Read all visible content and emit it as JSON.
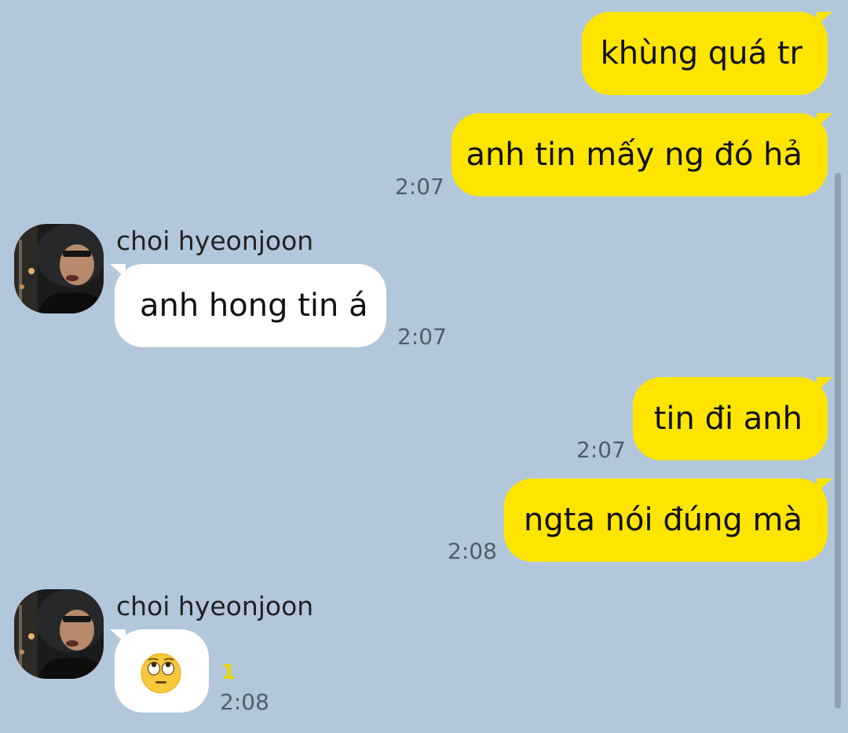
{
  "messages": [
    {
      "sender": "me",
      "text": "khùng quá tr"
    },
    {
      "sender": "me",
      "text": "anh tin mấy ng đó hả",
      "time": "2:07"
    },
    {
      "sender": "other",
      "name": "choi hyeonjoon",
      "text": "anh hong tin á",
      "time": "2:07"
    },
    {
      "sender": "me",
      "text": "tin đi anh",
      "time": "2:07"
    },
    {
      "sender": "me",
      "text": "ngta nói đúng mà",
      "time": "2:08"
    },
    {
      "sender": "other",
      "name": "choi hyeonjoon",
      "emoji": "face-with-rolling-eyes",
      "time": "2:08",
      "unread": "1"
    }
  ],
  "colors": {
    "background": "#b2c7da",
    "my_bubble": "#fee500",
    "their_bubble": "#ffffff",
    "unread": "#e7d600"
  },
  "icons": {
    "avatar": "avatar-photo",
    "reaction": "face-with-rolling-eyes-emoji"
  }
}
